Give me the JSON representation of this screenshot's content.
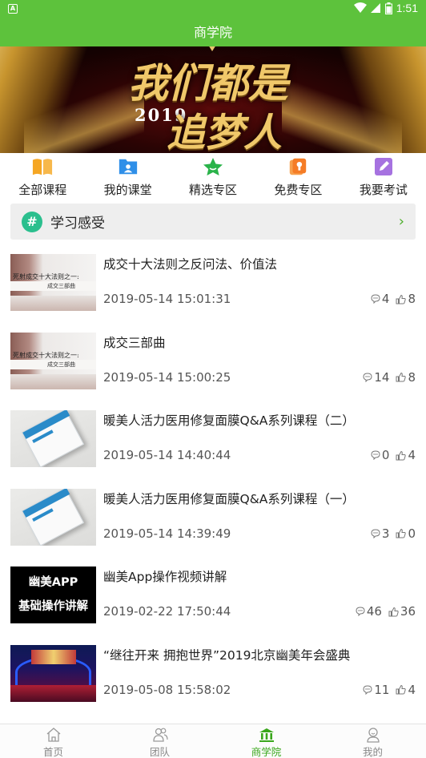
{
  "status_bar": {
    "time": "1:51"
  },
  "header": {
    "title": "商学院"
  },
  "banner": {
    "heading": "我们都是",
    "year": "2019",
    "subheading": "追梦人"
  },
  "categories": [
    {
      "label": "全部课程",
      "icon": "book-icon",
      "color": "#f5a623"
    },
    {
      "label": "我的课堂",
      "icon": "classroom-icon",
      "color": "#2f8fe8"
    },
    {
      "label": "精选专区",
      "icon": "star-icon",
      "color": "#2ab34a"
    },
    {
      "label": "免费专区",
      "icon": "free-icon",
      "color": "#f57c26"
    },
    {
      "label": "我要考试",
      "icon": "exam-icon",
      "color": "#a672e0"
    }
  ],
  "section": {
    "title": "学习感受",
    "icon": "hash-icon"
  },
  "courses": [
    {
      "title": "成交十大法则之反问法、价值法",
      "date": "2019-05-14 15:01:31",
      "comments": "4",
      "likes": "8",
      "thumb": {
        "type": "paper",
        "line1": "死射成交十大法则之一:",
        "line2": "成交三部曲"
      }
    },
    {
      "title": "成交三部曲",
      "date": "2019-05-14 15:00:25",
      "comments": "14",
      "likes": "8",
      "thumb": {
        "type": "paper",
        "line1": "死射成交十大法则之一:",
        "line2": "成交三部曲"
      }
    },
    {
      "title": "暖美人活力医用修复面膜Q&A系列课程（二）",
      "date": "2019-05-14 14:40:44",
      "comments": "0",
      "likes": "4",
      "thumb": {
        "type": "box"
      }
    },
    {
      "title": "暖美人活力医用修复面膜Q&A系列课程（一）",
      "date": "2019-05-14 14:39:49",
      "comments": "3",
      "likes": "0",
      "thumb": {
        "type": "box"
      }
    },
    {
      "title": "幽美App操作视频讲解",
      "date": "2019-02-22 17:50:44",
      "comments": "46",
      "likes": "36",
      "thumb": {
        "type": "app",
        "line1": "幽美APP",
        "line2": "基础操作讲解"
      }
    },
    {
      "title": "“继往开来 拥抱世界”2019北京幽美年会盛典",
      "date": "2019-05-08 15:58:02",
      "comments": "11",
      "likes": "4",
      "thumb": {
        "type": "stage"
      }
    }
  ],
  "tabs": [
    {
      "label": "首页",
      "icon": "home-icon",
      "active": false
    },
    {
      "label": "团队",
      "icon": "team-icon",
      "active": false
    },
    {
      "label": "商学院",
      "icon": "academy-icon",
      "active": true
    },
    {
      "label": "我的",
      "icon": "profile-icon",
      "active": false
    }
  ],
  "colors": {
    "brand": "#5dc23c",
    "active_tab": "#3aa71c",
    "text": "#222222",
    "muted": "#555555"
  }
}
